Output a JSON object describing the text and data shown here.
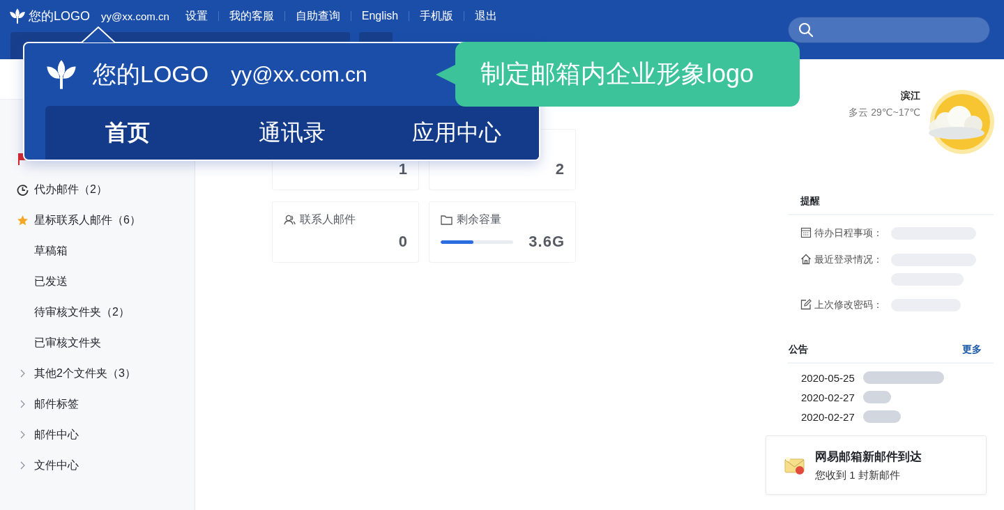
{
  "header": {
    "logo_text": "您的LOGO",
    "email": "yy@xx.com.cn",
    "links": [
      "设置",
      "我的客服",
      "自助查询",
      "English",
      "手机版",
      "退出"
    ]
  },
  "callout": {
    "logo_text": "您的LOGO",
    "email": "yy@xx.com.cn",
    "tooltip": "制定邮箱内企业形象logo",
    "tabs": [
      {
        "label": "首页",
        "selected": true
      },
      {
        "label": "通讯录",
        "selected": false
      },
      {
        "label": "应用中心",
        "selected": false
      }
    ]
  },
  "sidebar": {
    "items": [
      {
        "kind": "flag"
      },
      {
        "kind": "clock",
        "label": "代办邮件（2）"
      },
      {
        "kind": "star",
        "label": "星标联系人邮件（6）"
      },
      {
        "kind": "plain",
        "label": "草稿箱"
      },
      {
        "kind": "plain",
        "label": "已发送"
      },
      {
        "kind": "plain",
        "label": "待审核文件夹（2）"
      },
      {
        "kind": "plain",
        "label": "已审核文件夹"
      },
      {
        "kind": "group",
        "label": "其他2个文件夹（3）",
        "expanded": false
      },
      {
        "kind": "group",
        "label": "邮件标签",
        "expanded": false
      },
      {
        "kind": "group",
        "label": "邮件中心",
        "expanded": false
      },
      {
        "kind": "group",
        "label": "文件中心",
        "expanded": false
      }
    ]
  },
  "stats": [
    {
      "kind": "plain",
      "value": "1"
    },
    {
      "kind": "plain",
      "value": "2"
    },
    {
      "kind": "contacts",
      "label": "联系人邮件",
      "value": "0"
    },
    {
      "kind": "storage",
      "label": "剩余容量",
      "value": "3.6G",
      "level": 0.45
    }
  ],
  "weather": {
    "city": "滨江",
    "forecast": "多云 29℃~17℃"
  },
  "reminders": {
    "title": "提醒",
    "items": [
      {
        "kind": "calendar",
        "label": "待办日程事项："
      },
      {
        "kind": "home",
        "label": "最近登录情况："
      },
      {
        "kind": "edit",
        "label": "上次修改密码："
      }
    ]
  },
  "notices": {
    "title": "公告",
    "more": "更多",
    "items": [
      {
        "date": "2020-05-25"
      },
      {
        "date": "2020-02-27"
      },
      {
        "date": "2020-02-27"
      }
    ]
  },
  "toast": {
    "title": "网易邮箱新邮件到达",
    "body": "您收到 1 封新邮件"
  }
}
